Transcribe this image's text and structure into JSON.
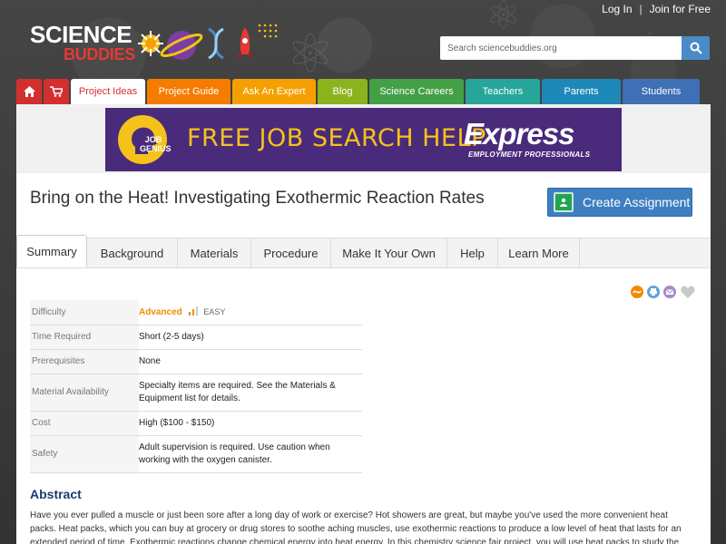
{
  "header": {
    "login_label": "Log In",
    "separator": "|",
    "join_label": "Join for Free"
  },
  "logo": {
    "line1": "SCIENCE",
    "line2": "BUDDIES"
  },
  "search": {
    "placeholder": "Search sciencebuddies.org"
  },
  "nav": {
    "items": [
      {
        "label": "",
        "icon": "home-icon",
        "color": "#d32f2f"
      },
      {
        "label": "",
        "icon": "cart-icon",
        "color": "#d32f2f"
      },
      {
        "label": "Project Ideas",
        "color": "#ffffff",
        "active": true
      },
      {
        "label": "Project Guide",
        "color": "#f57c00"
      },
      {
        "label": "Ask An Expert",
        "color": "#f5a000"
      },
      {
        "label": "Blog",
        "color": "#8bb31e"
      },
      {
        "label": "Science Careers",
        "color": "#43a047"
      },
      {
        "label": "Teachers",
        "color": "#26a69a"
      },
      {
        "label": "Parents",
        "color": "#1e88b8"
      },
      {
        "label": "Students",
        "color": "#3f6fb5"
      }
    ]
  },
  "ad": {
    "logo_text": "JOB GENIUS",
    "headline": "FREE JOB SEARCH HELP",
    "brand": "Express",
    "brand_sub": "EMPLOYMENT PROFESSIONALS"
  },
  "page": {
    "title": "Bring on the Heat! Investigating Exothermic Reaction Rates",
    "create_button": "Create Assignment"
  },
  "tabs": [
    {
      "label": "Summary",
      "active": true
    },
    {
      "label": "Background"
    },
    {
      "label": "Materials"
    },
    {
      "label": "Procedure"
    },
    {
      "label": "Make It Your Own"
    },
    {
      "label": "Help"
    },
    {
      "label": "Learn More"
    }
  ],
  "summary": {
    "difficulty_label": "Difficulty",
    "difficulty_value": "Advanced",
    "difficulty_easy": "EASY",
    "time_label": "Time Required",
    "time_value": "Short (2-5 days)",
    "prereq_label": "Prerequisites",
    "prereq_value": "None",
    "material_label": "Material Availability",
    "material_value": "Specialty items are required. See the Materials & Equipment list for details.",
    "cost_label": "Cost",
    "cost_value": "High ($100 - $150)",
    "safety_label": "Safety",
    "safety_value": "Adult supervision is required. Use caution when working with the oxygen canister."
  },
  "abstract": {
    "heading": "Abstract",
    "text": "Have you ever pulled a muscle or just been sore after a long day of work or exercise? Hot showers are great, but maybe you've used the more convenient heat packs. Heat packs, which you can buy at grocery or drug stores to soothe aching muscles, use exothermic reactions to produce a low level of heat that lasts for an extended period of time. Exothermic reactions change chemical energy into heat energy. In this chemistry science fair project, you will use heat packs to study the"
  }
}
